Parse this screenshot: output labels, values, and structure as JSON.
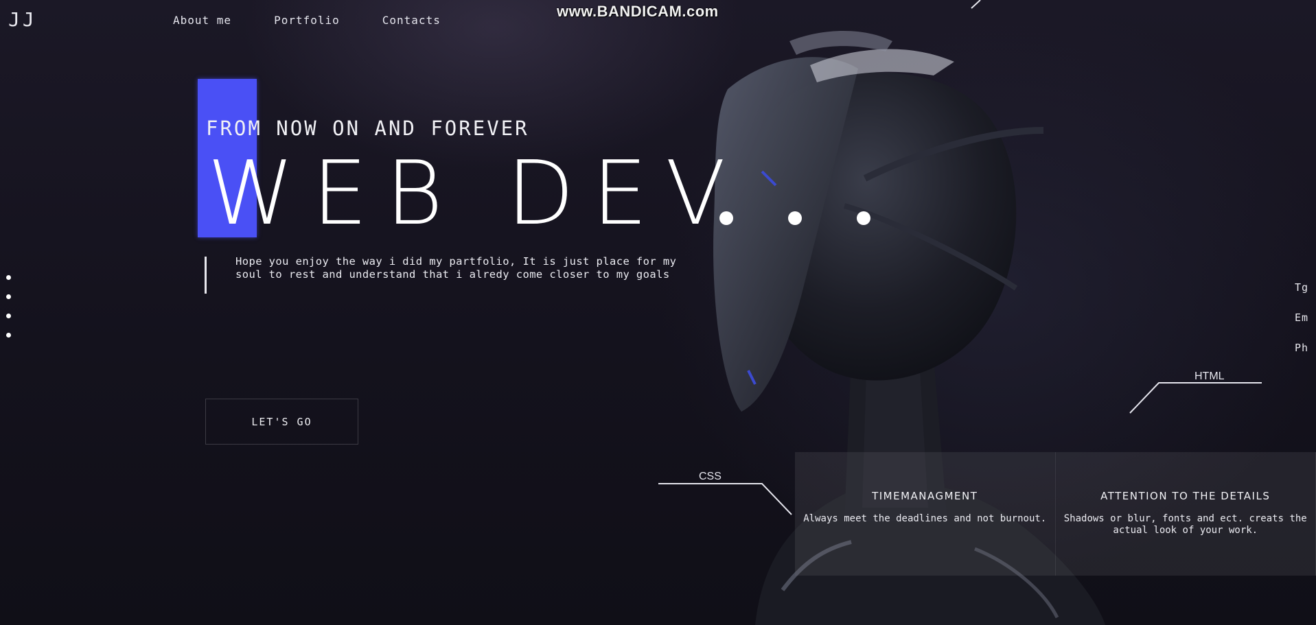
{
  "brand": {
    "logo": "JJ"
  },
  "nav": {
    "items": [
      "About me",
      "Portfolio",
      "Contacts"
    ]
  },
  "watermark": "www.BANDICAM.com",
  "hero": {
    "tagline": "FROM NOW ON AND FOREVER",
    "headline": "WEB DEV",
    "intro": "Hope you enjoy the way i did my partfolio, It is just place for my soul to rest and understand that i alredy come closer to my goals",
    "cta": "LET'S GO",
    "accent_color": "#4a50f5"
  },
  "contacts": [
    "Tg",
    "Em",
    "Ph"
  ],
  "skills": {
    "left": "CSS",
    "right": "HTML"
  },
  "cards": [
    {
      "title": "TIMEMANAGMENT",
      "text": "Always meet the deadlines and not burnout."
    },
    {
      "title": "ATTENTION TO THE DETAILS",
      "text": "Shadows or blur, fonts and ect. creats the actual look of your work."
    }
  ]
}
